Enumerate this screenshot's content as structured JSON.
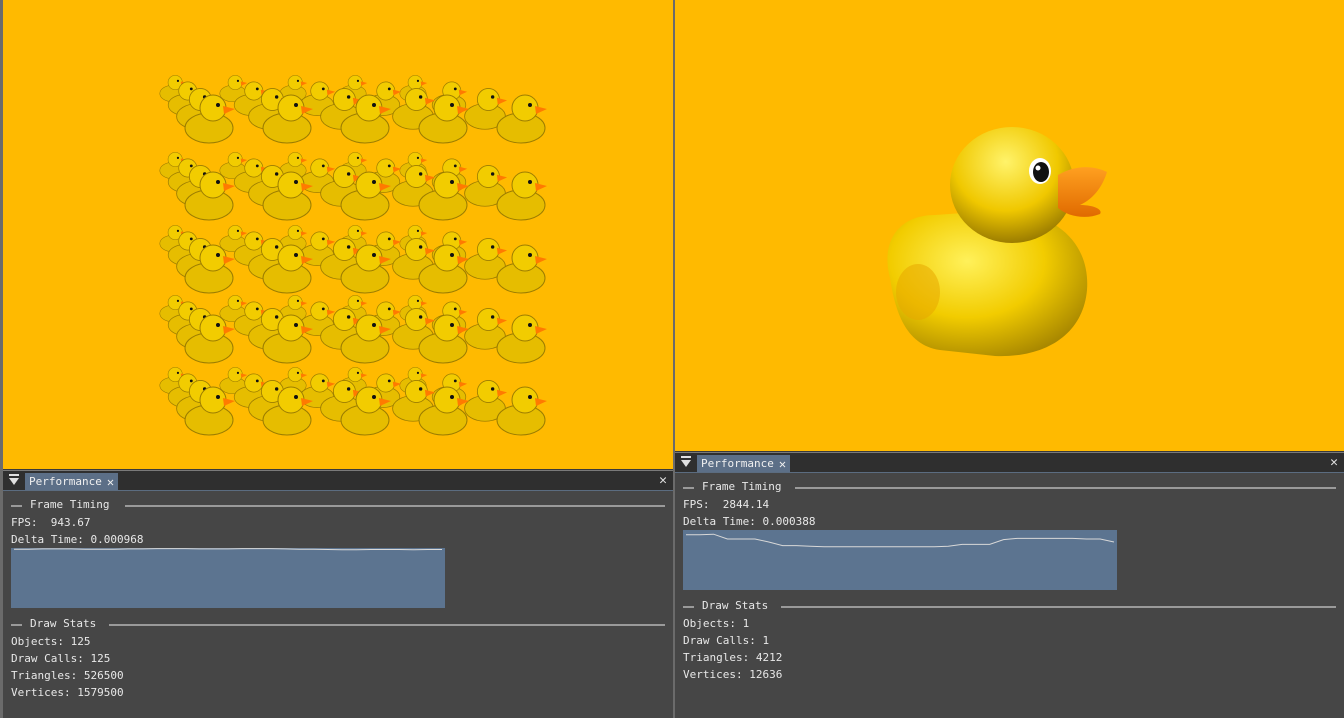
{
  "left_panel": {
    "tab_label": "Performance",
    "close_glyph": "✕",
    "panel_close_glyph": "✕",
    "frame_timing": {
      "heading": "Frame Timing",
      "fps_label": "FPS:",
      "fps_value": "943.67",
      "delta_label": "Delta Time:",
      "delta_value": "0.000968",
      "plot_values": [
        0.98,
        0.98,
        0.985,
        0.985,
        0.985,
        0.98,
        0.98,
        0.98,
        0.985,
        0.985,
        0.99,
        0.99,
        0.99,
        0.985,
        0.985,
        0.985,
        0.99,
        0.99,
        0.99,
        0.985,
        0.98,
        0.98,
        0.975,
        0.97,
        0.97,
        0.975,
        0.975,
        0.975,
        0.97,
        0.975,
        0.975
      ]
    },
    "draw_stats": {
      "heading": "Draw Stats",
      "objects": "Objects: 125",
      "draw_calls": "Draw Calls: 125",
      "triangles": "Triangles: 526500",
      "vertices": "Vertices: 1579500"
    }
  },
  "right_panel": {
    "tab_label": "Performance",
    "close_glyph": "✕",
    "panel_close_glyph": "✕",
    "frame_timing": {
      "heading": "Frame Timing",
      "fps_label": "FPS:",
      "fps_value": "2844.14",
      "delta_label": "Delta Time:",
      "delta_value": "0.000388",
      "plot_values": [
        0.92,
        0.92,
        0.93,
        0.85,
        0.85,
        0.85,
        0.8,
        0.74,
        0.74,
        0.73,
        0.72,
        0.72,
        0.72,
        0.72,
        0.72,
        0.72,
        0.72,
        0.72,
        0.72,
        0.73,
        0.76,
        0.76,
        0.76,
        0.84,
        0.86,
        0.86,
        0.86,
        0.86,
        0.86,
        0.85,
        0.85,
        0.8
      ]
    },
    "draw_stats": {
      "heading": "Draw Stats",
      "objects": "Objects: 1",
      "draw_calls": "Draw Calls: 1",
      "triangles": "Triangles: 4212",
      "vertices": "Vertices: 12636"
    }
  },
  "colors": {
    "viewport_bg": "#ffba00",
    "panel_bg": "#464646",
    "tab_active": "#5c6f87",
    "plot_bg": "#5c7490",
    "duck_body": "#f5d000",
    "duck_beak": "#ff8a00"
  }
}
